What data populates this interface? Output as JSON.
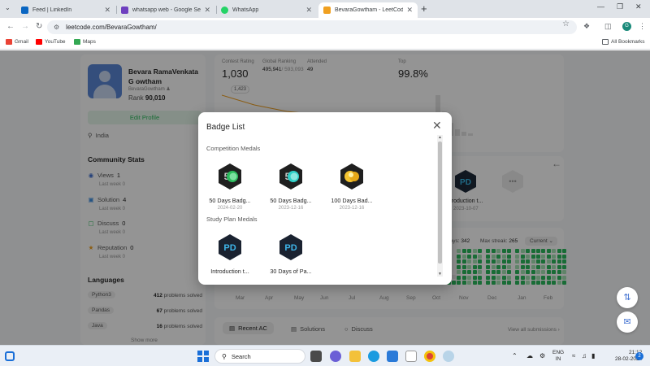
{
  "browser": {
    "tabs": [
      {
        "title": "Feed | LinkedIn",
        "favicon_color": "#0a66c2"
      },
      {
        "title": "whatsapp web - Google Search",
        "favicon_color": "#6e3fbf"
      },
      {
        "title": "WhatsApp",
        "favicon_color": "#25d366"
      },
      {
        "title": "BevaraGowtham - LeetCode Profile",
        "favicon_color": "#f0a020"
      }
    ],
    "new_tab_glyph": "+",
    "url": "leetcode.com/BevaraGowtham/",
    "profile_initial": "G",
    "bookmarks": [
      {
        "label": "Gmail",
        "icon": "gmail-icon",
        "color": "#ea4335"
      },
      {
        "label": "YouTube",
        "icon": "youtube-icon",
        "color": "#ff0000"
      },
      {
        "label": "Maps",
        "icon": "maps-icon",
        "color": "#34a853"
      }
    ],
    "all_bookmarks_label": "All Bookmarks"
  },
  "profile": {
    "name": "Bevara RamaVenkata G owtham",
    "handle": "BevaraGowtham",
    "rank_label": "Rank",
    "rank_value": "90,010",
    "edit_label": "Edit Profile",
    "location": "India"
  },
  "community": {
    "title": "Community Stats",
    "items": [
      {
        "label": "Views",
        "value": "1",
        "sub": "Last week 0",
        "icon": "eye-icon",
        "color": "#3e6fd0"
      },
      {
        "label": "Solution",
        "value": "4",
        "sub": "Last week 0",
        "icon": "solution-icon",
        "color": "#3e8fe0"
      },
      {
        "label": "Discuss",
        "value": "0",
        "sub": "Last week 0",
        "icon": "discuss-icon",
        "color": "#2cbb5d"
      },
      {
        "label": "Reputation",
        "value": "0",
        "sub": "Last week 0",
        "icon": "reputation-icon",
        "color": "#f0a020"
      }
    ]
  },
  "languages": {
    "title": "Languages",
    "items": [
      {
        "name": "Python3",
        "count": "412",
        "suffix": "problems solved"
      },
      {
        "name": "Pandas",
        "count": "67",
        "suffix": "problems solved"
      },
      {
        "name": "Java",
        "count": "16",
        "suffix": "problems solved"
      }
    ],
    "show_more": "Show more"
  },
  "contest": {
    "rating_label": "Contest Rating",
    "rating_value": "1,030",
    "global_label": "Global Ranking",
    "global_value": "495,941",
    "global_total": "/ 593,093",
    "attended_label": "Attended",
    "attended_value": "49",
    "top_label": "Top",
    "top_value": "99.8%",
    "point_label": "1,423"
  },
  "heatmap": {
    "active_days_label": "days:",
    "active_days_value": "342",
    "max_streak_label": "Max streak:",
    "max_streak_value": "265",
    "period_select": "Current",
    "months": [
      "Mar",
      "Apr",
      "May",
      "Jun",
      "Jul",
      "Aug",
      "Sep",
      "Oct",
      "Nov",
      "Dec",
      "Jan",
      "Feb"
    ]
  },
  "behind_badges": [
    {
      "name": "Introduction t...",
      "date": "2023-10-07"
    }
  ],
  "recent": {
    "tabs": [
      {
        "label": "Recent AC",
        "icon": "list-icon"
      },
      {
        "label": "Solutions",
        "icon": "solutions-icon"
      },
      {
        "label": "Discuss",
        "icon": "discuss-icon"
      }
    ],
    "view_all": "View all submissions"
  },
  "modal": {
    "title": "Badge List",
    "sections": [
      {
        "title": "Competition Medals",
        "badges": [
          {
            "name": "50 Days Badg...",
            "date": "2024-02-20",
            "art": "fifty-days-badge-2024-icon"
          },
          {
            "name": "50 Days Badg...",
            "date": "2023-12-16",
            "art": "fifty-days-badge-2023-icon"
          },
          {
            "name": "100 Days Bad...",
            "date": "2023-12-16",
            "art": "hundred-days-badge-icon"
          }
        ]
      },
      {
        "title": "Study Plan Medals",
        "badges": [
          {
            "name": "Introduction t...",
            "date": "",
            "art": "pandas-intro-badge-icon"
          },
          {
            "name": "30 Days of Pa...",
            "date": "",
            "art": "pandas-30-days-badge-icon"
          }
        ]
      }
    ]
  },
  "taskbar": {
    "search_placeholder": "Search",
    "lang_top": "ENG",
    "lang_bottom": "IN",
    "time": "21:12",
    "date": "28-02-2024",
    "notifications": "2"
  }
}
